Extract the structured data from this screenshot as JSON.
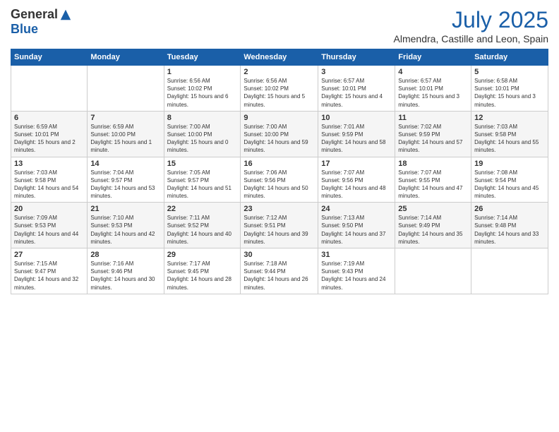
{
  "header": {
    "logo_general": "General",
    "logo_blue": "Blue",
    "month_year": "July 2025",
    "location": "Almendra, Castille and Leon, Spain"
  },
  "days_of_week": [
    "Sunday",
    "Monday",
    "Tuesday",
    "Wednesday",
    "Thursday",
    "Friday",
    "Saturday"
  ],
  "weeks": [
    [
      {
        "day": "",
        "info": ""
      },
      {
        "day": "",
        "info": ""
      },
      {
        "day": "1",
        "info": "Sunrise: 6:56 AM\nSunset: 10:02 PM\nDaylight: 15 hours and 6 minutes."
      },
      {
        "day": "2",
        "info": "Sunrise: 6:56 AM\nSunset: 10:02 PM\nDaylight: 15 hours and 5 minutes."
      },
      {
        "day": "3",
        "info": "Sunrise: 6:57 AM\nSunset: 10:01 PM\nDaylight: 15 hours and 4 minutes."
      },
      {
        "day": "4",
        "info": "Sunrise: 6:57 AM\nSunset: 10:01 PM\nDaylight: 15 hours and 3 minutes."
      },
      {
        "day": "5",
        "info": "Sunrise: 6:58 AM\nSunset: 10:01 PM\nDaylight: 15 hours and 3 minutes."
      }
    ],
    [
      {
        "day": "6",
        "info": "Sunrise: 6:59 AM\nSunset: 10:01 PM\nDaylight: 15 hours and 2 minutes."
      },
      {
        "day": "7",
        "info": "Sunrise: 6:59 AM\nSunset: 10:00 PM\nDaylight: 15 hours and 1 minute."
      },
      {
        "day": "8",
        "info": "Sunrise: 7:00 AM\nSunset: 10:00 PM\nDaylight: 15 hours and 0 minutes."
      },
      {
        "day": "9",
        "info": "Sunrise: 7:00 AM\nSunset: 10:00 PM\nDaylight: 14 hours and 59 minutes."
      },
      {
        "day": "10",
        "info": "Sunrise: 7:01 AM\nSunset: 9:59 PM\nDaylight: 14 hours and 58 minutes."
      },
      {
        "day": "11",
        "info": "Sunrise: 7:02 AM\nSunset: 9:59 PM\nDaylight: 14 hours and 57 minutes."
      },
      {
        "day": "12",
        "info": "Sunrise: 7:03 AM\nSunset: 9:58 PM\nDaylight: 14 hours and 55 minutes."
      }
    ],
    [
      {
        "day": "13",
        "info": "Sunrise: 7:03 AM\nSunset: 9:58 PM\nDaylight: 14 hours and 54 minutes."
      },
      {
        "day": "14",
        "info": "Sunrise: 7:04 AM\nSunset: 9:57 PM\nDaylight: 14 hours and 53 minutes."
      },
      {
        "day": "15",
        "info": "Sunrise: 7:05 AM\nSunset: 9:57 PM\nDaylight: 14 hours and 51 minutes."
      },
      {
        "day": "16",
        "info": "Sunrise: 7:06 AM\nSunset: 9:56 PM\nDaylight: 14 hours and 50 minutes."
      },
      {
        "day": "17",
        "info": "Sunrise: 7:07 AM\nSunset: 9:56 PM\nDaylight: 14 hours and 48 minutes."
      },
      {
        "day": "18",
        "info": "Sunrise: 7:07 AM\nSunset: 9:55 PM\nDaylight: 14 hours and 47 minutes."
      },
      {
        "day": "19",
        "info": "Sunrise: 7:08 AM\nSunset: 9:54 PM\nDaylight: 14 hours and 45 minutes."
      }
    ],
    [
      {
        "day": "20",
        "info": "Sunrise: 7:09 AM\nSunset: 9:53 PM\nDaylight: 14 hours and 44 minutes."
      },
      {
        "day": "21",
        "info": "Sunrise: 7:10 AM\nSunset: 9:53 PM\nDaylight: 14 hours and 42 minutes."
      },
      {
        "day": "22",
        "info": "Sunrise: 7:11 AM\nSunset: 9:52 PM\nDaylight: 14 hours and 40 minutes."
      },
      {
        "day": "23",
        "info": "Sunrise: 7:12 AM\nSunset: 9:51 PM\nDaylight: 14 hours and 39 minutes."
      },
      {
        "day": "24",
        "info": "Sunrise: 7:13 AM\nSunset: 9:50 PM\nDaylight: 14 hours and 37 minutes."
      },
      {
        "day": "25",
        "info": "Sunrise: 7:14 AM\nSunset: 9:49 PM\nDaylight: 14 hours and 35 minutes."
      },
      {
        "day": "26",
        "info": "Sunrise: 7:14 AM\nSunset: 9:48 PM\nDaylight: 14 hours and 33 minutes."
      }
    ],
    [
      {
        "day": "27",
        "info": "Sunrise: 7:15 AM\nSunset: 9:47 PM\nDaylight: 14 hours and 32 minutes."
      },
      {
        "day": "28",
        "info": "Sunrise: 7:16 AM\nSunset: 9:46 PM\nDaylight: 14 hours and 30 minutes."
      },
      {
        "day": "29",
        "info": "Sunrise: 7:17 AM\nSunset: 9:45 PM\nDaylight: 14 hours and 28 minutes."
      },
      {
        "day": "30",
        "info": "Sunrise: 7:18 AM\nSunset: 9:44 PM\nDaylight: 14 hours and 26 minutes."
      },
      {
        "day": "31",
        "info": "Sunrise: 7:19 AM\nSunset: 9:43 PM\nDaylight: 14 hours and 24 minutes."
      },
      {
        "day": "",
        "info": ""
      },
      {
        "day": "",
        "info": ""
      }
    ]
  ]
}
